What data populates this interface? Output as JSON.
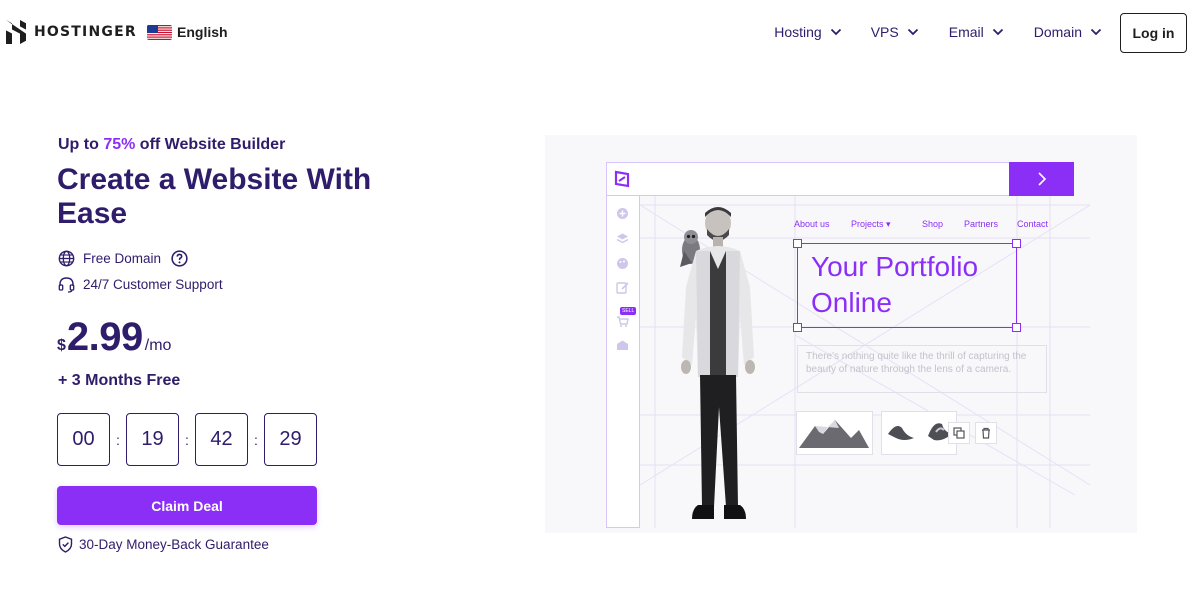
{
  "header": {
    "brand": "HOSTINGER",
    "language": "English",
    "nav": [
      {
        "label": "Hosting"
      },
      {
        "label": "VPS"
      },
      {
        "label": "Email"
      },
      {
        "label": "Domain"
      }
    ],
    "login_label": "Log in"
  },
  "hero": {
    "promo_prefix": "Up to ",
    "promo_percent": "75%",
    "promo_suffix": " off Website Builder",
    "title": "Create a Website With Ease",
    "features": [
      {
        "label": "Free Domain",
        "icon": "globe-icon"
      },
      {
        "label": "24/7 Customer Support",
        "icon": "headset-icon"
      }
    ],
    "price": {
      "currency": "$",
      "amount": "2.99",
      "period": "/mo"
    },
    "bonus": "+ 3 Months Free",
    "timer": [
      "00",
      "19",
      "42",
      "29"
    ],
    "timer_separator": ":",
    "cta_label": "Claim Deal",
    "guarantee": "30-Day Money-Back Guarantee"
  },
  "illustration": {
    "site_nav": [
      "About us",
      "Projects ▾",
      "Shop",
      "Partners",
      "Contact"
    ],
    "headline": "Your Portfolio Online",
    "headline_line1": "Your Portfolio",
    "headline_line2": "Online",
    "paragraph": "There's nothing quite like the thrill of capturing the beauty of nature through the lens of a camera.",
    "sidebar_badge": "SELL"
  },
  "colors": {
    "primary": "#8c2ff6",
    "text_dark": "#2f1c6a",
    "accent_light": "#d5c6fb"
  }
}
